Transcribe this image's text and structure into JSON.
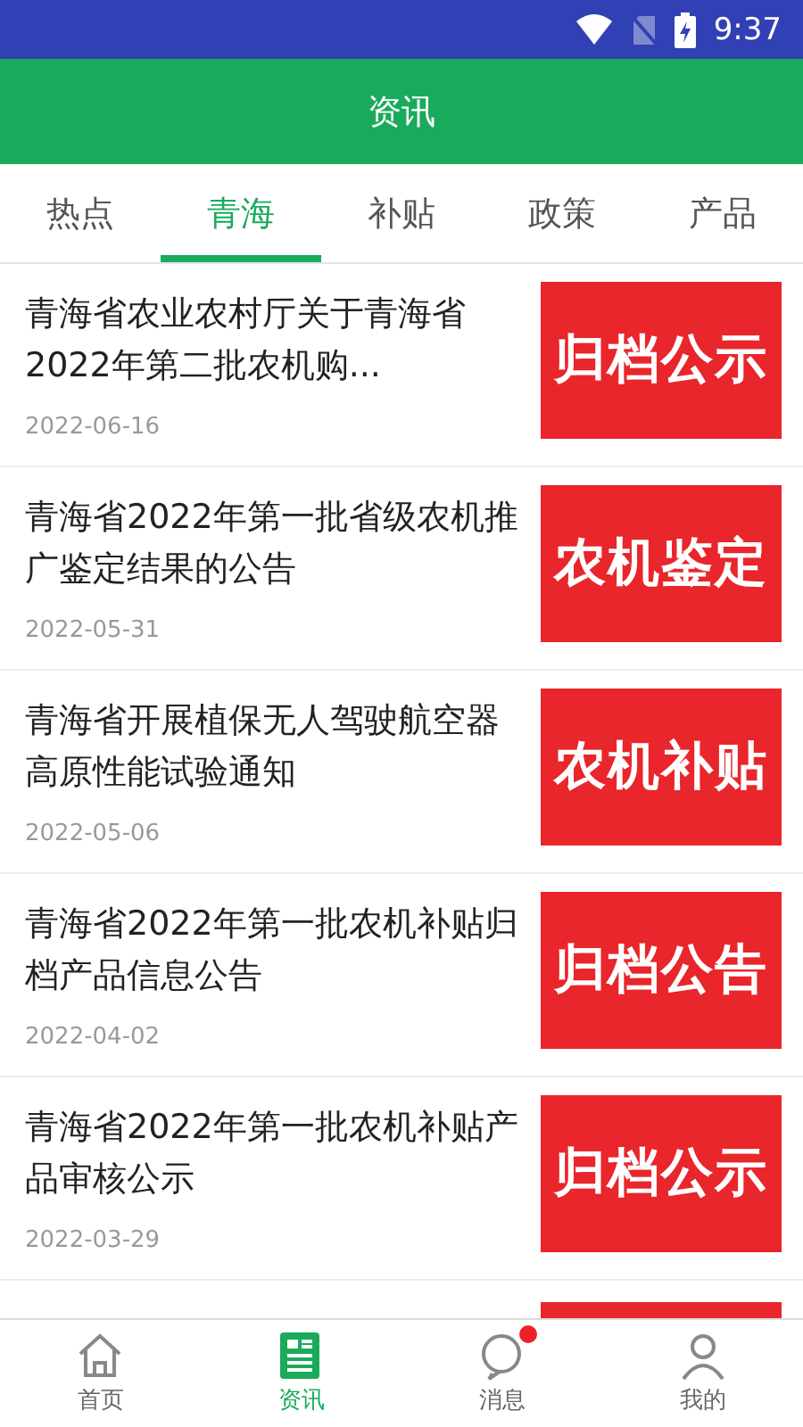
{
  "status_bar": {
    "time": "9:37"
  },
  "header": {
    "title": "资讯"
  },
  "tabs": [
    {
      "label": "热点",
      "selected": false
    },
    {
      "label": "青海",
      "selected": true
    },
    {
      "label": "补贴",
      "selected": false
    },
    {
      "label": "政策",
      "selected": false
    },
    {
      "label": "产品",
      "selected": false
    }
  ],
  "articles": [
    {
      "title": "青海省农业农村厅关于青海省2022年第二批农机购...",
      "date": "2022-06-16",
      "thumbnail": "归档公示"
    },
    {
      "title": "青海省2022年第一批省级农机推广鉴定结果的公告",
      "date": "2022-05-31",
      "thumbnail": "农机鉴定"
    },
    {
      "title": "青海省开展植保无人驾驶航空器高原性能试验通知",
      "date": "2022-05-06",
      "thumbnail": "农机补贴"
    },
    {
      "title": "青海省2022年第一批农机补贴归档产品信息公告",
      "date": "2022-04-02",
      "thumbnail": "归档公告"
    },
    {
      "title": "青海省2022年第一批农机补贴产品审核公示",
      "date": "2022-03-29",
      "thumbnail": "归档公示"
    }
  ],
  "bottom_nav": [
    {
      "label": "首页",
      "kind": "home",
      "selected": false,
      "badge": false
    },
    {
      "label": "资讯",
      "kind": "news",
      "selected": true,
      "badge": false
    },
    {
      "label": "消息",
      "kind": "message",
      "selected": false,
      "badge": true
    },
    {
      "label": "我的",
      "kind": "profile",
      "selected": false,
      "badge": false
    }
  ]
}
